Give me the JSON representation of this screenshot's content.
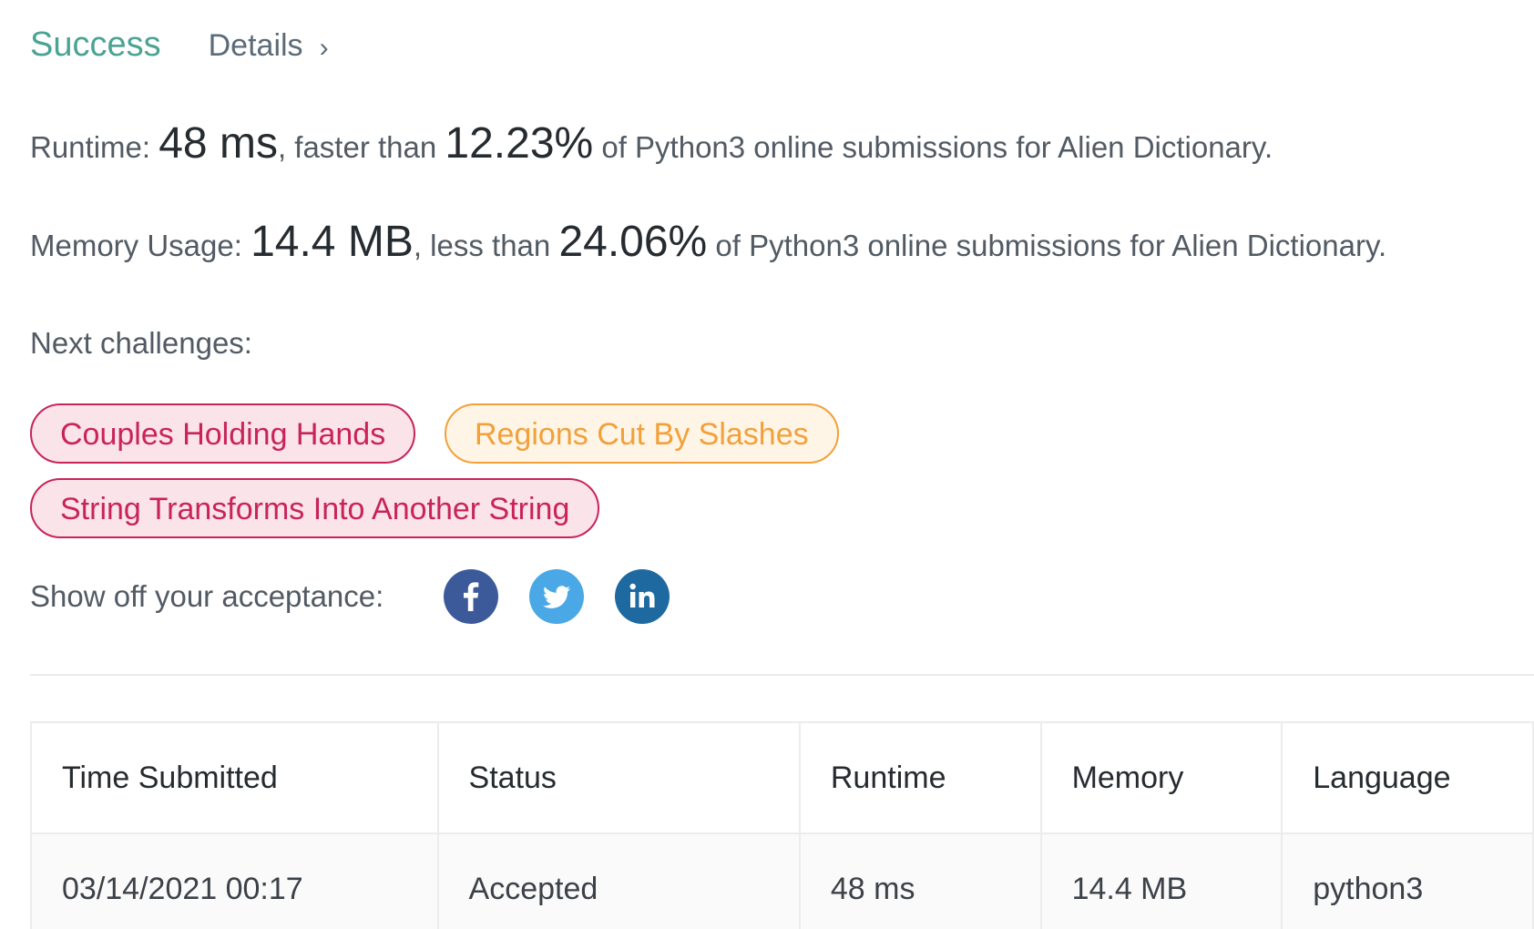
{
  "header": {
    "status": "Success",
    "details_label": "Details"
  },
  "runtime": {
    "label": "Runtime:",
    "value": "48 ms",
    "comparison": ", faster than",
    "percent": "12.23%",
    "suffix": "of Python3 online submissions for Alien Dictionary."
  },
  "memory": {
    "label": "Memory Usage:",
    "value": "14.4 MB",
    "comparison": ", less than",
    "percent": "24.06%",
    "suffix": "of Python3 online submissions for Alien Dictionary."
  },
  "next_challenges": {
    "label": "Next challenges:",
    "items": [
      {
        "title": "Couples Holding Hands",
        "difficulty": "hard"
      },
      {
        "title": "Regions Cut By Slashes",
        "difficulty": "medium"
      },
      {
        "title": "String Transforms Into Another String",
        "difficulty": "hard"
      }
    ]
  },
  "share": {
    "label": "Show off your acceptance:",
    "icons": [
      "facebook-icon",
      "twitter-icon",
      "linkedin-icon"
    ]
  },
  "submissions": {
    "columns": [
      "Time Submitted",
      "Status",
      "Runtime",
      "Memory",
      "Language"
    ],
    "rows": [
      {
        "time": "03/14/2021 00:17",
        "status": "Accepted",
        "runtime": "48 ms",
        "memory": "14.4 MB",
        "language": "python3"
      }
    ]
  },
  "colors": {
    "success": "#4ba393",
    "hard": "#c8245a",
    "medium": "#f2a03a",
    "facebook": "#3c5a9a",
    "twitter": "#4aa8e6",
    "linkedin": "#1e6aa0"
  }
}
